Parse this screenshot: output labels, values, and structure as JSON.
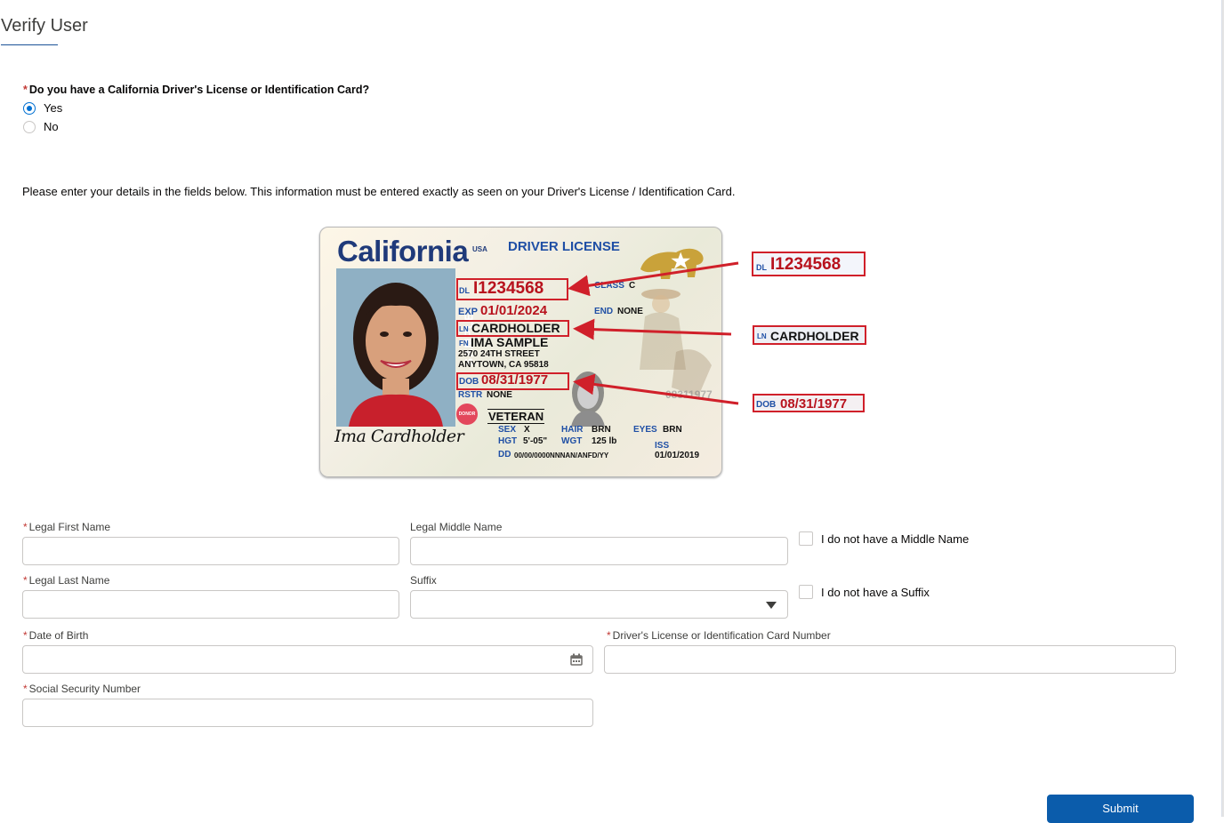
{
  "page": {
    "title": "Verify User"
  },
  "question": {
    "label": "Do you have a California Driver's License or Identification Card?",
    "options": [
      "Yes",
      "No"
    ],
    "selected": "Yes"
  },
  "instructions": "Please enter your details in the fields below. This information must be entered exactly as seen on your Driver's License / Identification Card.",
  "license_image": {
    "state": "California",
    "usa": "USA",
    "type": "DRIVER LICENSE",
    "dl_prefix": "DL",
    "dl_number": "I1234568",
    "class_label": "CLASS",
    "class_value": "C",
    "exp_label": "EXP",
    "exp_value": "01/01/2024",
    "end_label": "END",
    "end_value": "NONE",
    "ln_prefix": "LN",
    "ln_value": "CARDHOLDER",
    "fn_prefix": "FN",
    "fn_value": "IMA SAMPLE",
    "address1": "2570 24TH STREET",
    "address2": "ANYTOWN, CA 95818",
    "dob_prefix": "DOB",
    "dob_value": "08/31/1977",
    "rstr_label": "RSTR",
    "rstr_value": "NONE",
    "veteran": "VETERAN",
    "donor": "DONOR",
    "sample": "SAMPLE",
    "sex_label": "SEX",
    "sex_value": "X",
    "hgt_label": "HGT",
    "hgt_value": "5'-05\"",
    "hair_label": "HAIR",
    "hair_value": "BRN",
    "eyes_label": "EYES",
    "eyes_value": "BRN",
    "wgt_label": "WGT",
    "wgt_value": "125 lb",
    "dd_label": "DD",
    "dd_value": "00/00/0000NNNAN/ANFD/YY",
    "iss_label": "ISS",
    "iss_value": "01/01/2019",
    "ghost_dob": "08311977",
    "signature": "Ima Cardholder"
  },
  "form": {
    "first_name": {
      "label": "Legal First Name",
      "required": true,
      "value": ""
    },
    "middle_name": {
      "label": "Legal Middle Name",
      "required": false,
      "value": ""
    },
    "no_middle": {
      "label": "I do not have a Middle Name",
      "checked": false
    },
    "last_name": {
      "label": "Legal Last Name",
      "required": true,
      "value": ""
    },
    "suffix": {
      "label": "Suffix",
      "required": false,
      "value": ""
    },
    "no_suffix": {
      "label": "I do not have a Suffix",
      "checked": false
    },
    "dob": {
      "label": "Date of Birth",
      "required": true,
      "value": ""
    },
    "license_number": {
      "label": "Driver's License or Identification Card Number",
      "required": true,
      "value": ""
    },
    "ssn": {
      "label": "Social Security Number",
      "required": true,
      "value": ""
    }
  },
  "submit_label": "Submit",
  "colors": {
    "accent": "#0070d2",
    "required": "#c23934",
    "highlight": "#d0202a",
    "submit": "#0b5cab"
  },
  "icons": {
    "calendar": "calendar-icon",
    "dropdown": "chevron-down-icon"
  }
}
